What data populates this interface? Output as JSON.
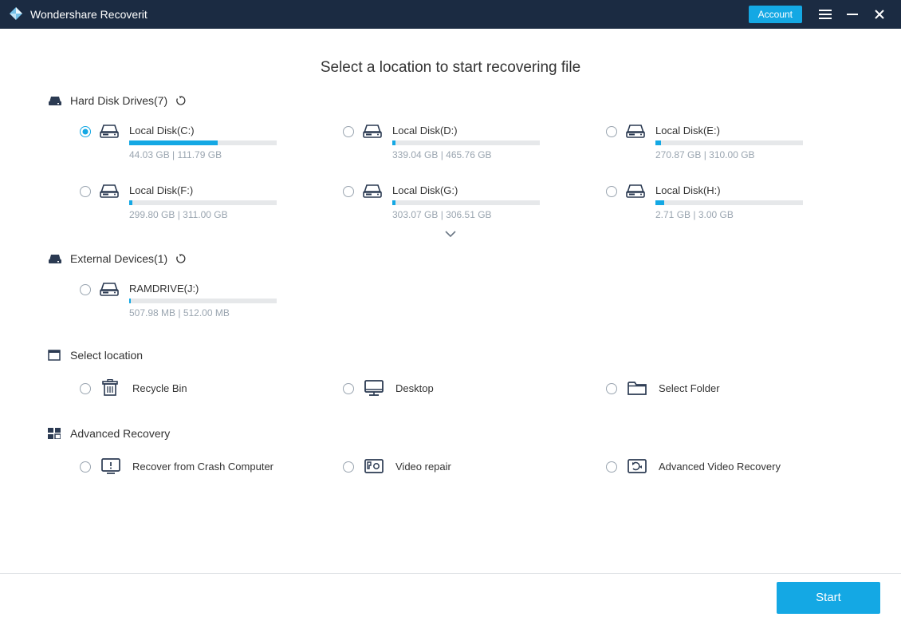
{
  "titlebar": {
    "app_name": "Wondershare Recoverit",
    "account_label": "Account"
  },
  "page_title": "Select a location to start recovering file",
  "sections": {
    "hdd": {
      "label": "Hard Disk Drives(7)",
      "drives": [
        {
          "name": "Local Disk(C:)",
          "size": "44.03 GB | 111.79 GB",
          "fill_pct": 60,
          "selected": true
        },
        {
          "name": "Local Disk(D:)",
          "size": "339.04 GB | 465.76 GB",
          "fill_pct": 2,
          "selected": false
        },
        {
          "name": "Local Disk(E:)",
          "size": "270.87 GB | 310.00 GB",
          "fill_pct": 4,
          "selected": false
        },
        {
          "name": "Local Disk(F:)",
          "size": "299.80 GB | 311.00 GB",
          "fill_pct": 2,
          "selected": false
        },
        {
          "name": "Local Disk(G:)",
          "size": "303.07 GB | 306.51 GB",
          "fill_pct": 2,
          "selected": false
        },
        {
          "name": "Local Disk(H:)",
          "size": "2.71 GB | 3.00 GB",
          "fill_pct": 6,
          "selected": false
        }
      ]
    },
    "external": {
      "label": "External Devices(1)",
      "drives": [
        {
          "name": "RAMDRIVE(J:)",
          "size": "507.98 MB | 512.00 MB",
          "fill_pct": 1,
          "selected": false
        }
      ]
    },
    "location": {
      "label": "Select location",
      "items": [
        {
          "name": "Recycle Bin"
        },
        {
          "name": "Desktop"
        },
        {
          "name": "Select Folder"
        }
      ]
    },
    "advanced": {
      "label": "Advanced Recovery",
      "items": [
        {
          "name": "Recover from Crash Computer"
        },
        {
          "name": "Video repair"
        },
        {
          "name": "Advanced Video Recovery"
        }
      ]
    }
  },
  "footer": {
    "start_label": "Start"
  },
  "colors": {
    "accent": "#14a8e4",
    "titlebar": "#1b2b42"
  }
}
